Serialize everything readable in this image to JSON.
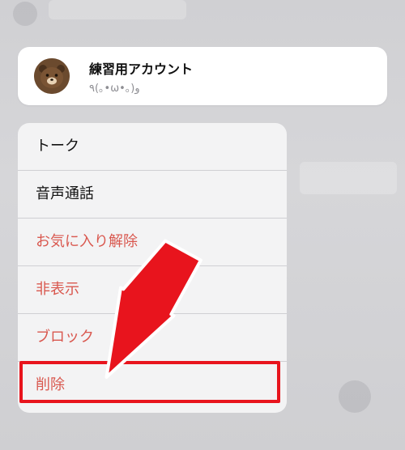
{
  "contact": {
    "name": "練習用アカウント",
    "status": "٩(｡•ω•｡)و"
  },
  "menu": {
    "items": [
      {
        "label": "トーク",
        "kind": "normal"
      },
      {
        "label": "音声通話",
        "kind": "normal"
      },
      {
        "label": "お気に入り解除",
        "kind": "danger"
      },
      {
        "label": "非表示",
        "kind": "danger"
      },
      {
        "label": "ブロック",
        "kind": "danger"
      },
      {
        "label": "削除",
        "kind": "danger"
      }
    ]
  },
  "annotation": {
    "arrow_icon": "red-pointer-arrow-icon",
    "highlight_color": "#e8141d"
  },
  "colors": {
    "danger_text": "#d9584f",
    "normal_text": "#111111",
    "annotation_red": "#e8141d"
  }
}
